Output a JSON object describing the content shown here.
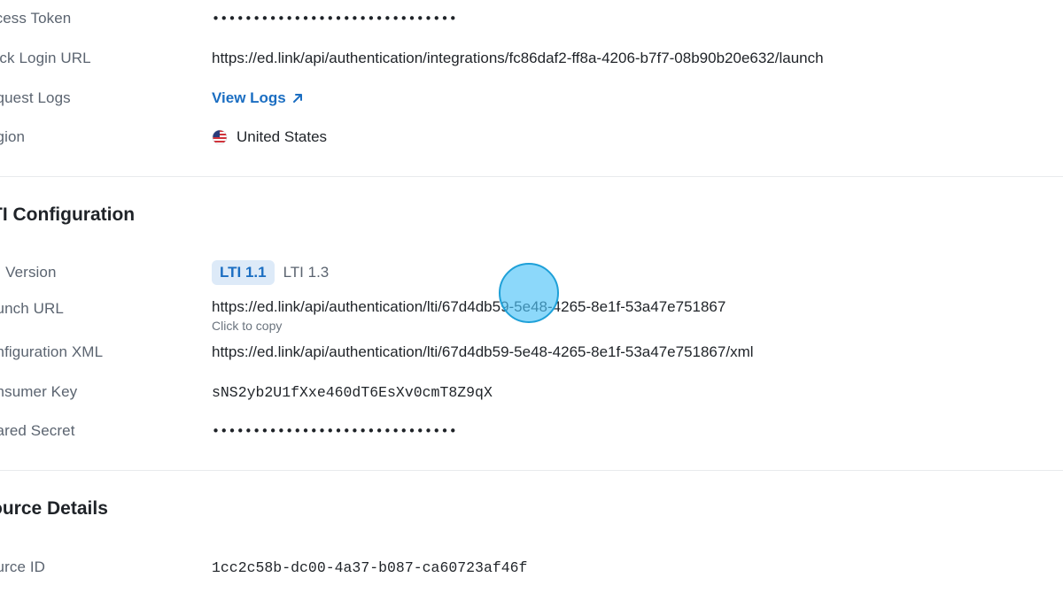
{
  "access": {
    "token_label": "ccess Token",
    "token_value": "••••••••••••••••••••••••••••••",
    "quick_login_label": "uick Login URL",
    "quick_login_value": "https://ed.link/api/authentication/integrations/fc86daf2-ff8a-4206-b7f7-08b90b20e632/launch",
    "request_logs_label": "equest Logs",
    "request_logs_link": "View Logs",
    "region_label": "egion",
    "region_value": "United States"
  },
  "lti": {
    "title": "TI Configuration",
    "version_label": "TI Version",
    "versions": [
      "LTI 1.1",
      "LTI 1.3"
    ],
    "launch_label": "aunch URL",
    "launch_value": "https://ed.link/api/authentication/lti/67d4db59-5e48-4265-8e1f-53a47e751867",
    "launch_hint": "Click to copy",
    "xml_label": "onfiguration XML",
    "xml_value": "https://ed.link/api/authentication/lti/67d4db59-5e48-4265-8e1f-53a47e751867/xml",
    "consumer_label": "onsumer Key",
    "consumer_value": "sNS2yb2U1fXxe460dT6EsXv0cmT8Z9qX",
    "secret_label": "hared Secret",
    "secret_value": "••••••••••••••••••••••••••••••"
  },
  "source": {
    "title": "ource Details",
    "id_label": "ource ID",
    "id_value": "1cc2c58b-dc00-4a37-b087-ca60723af46f"
  },
  "colors": {
    "accent": "#1b6ec2",
    "pill_bg": "#ddeaf8",
    "cursor": "#4fc3f7"
  },
  "icons": {
    "external": "arrow-up-right-icon",
    "flag": "us-flag-icon"
  }
}
